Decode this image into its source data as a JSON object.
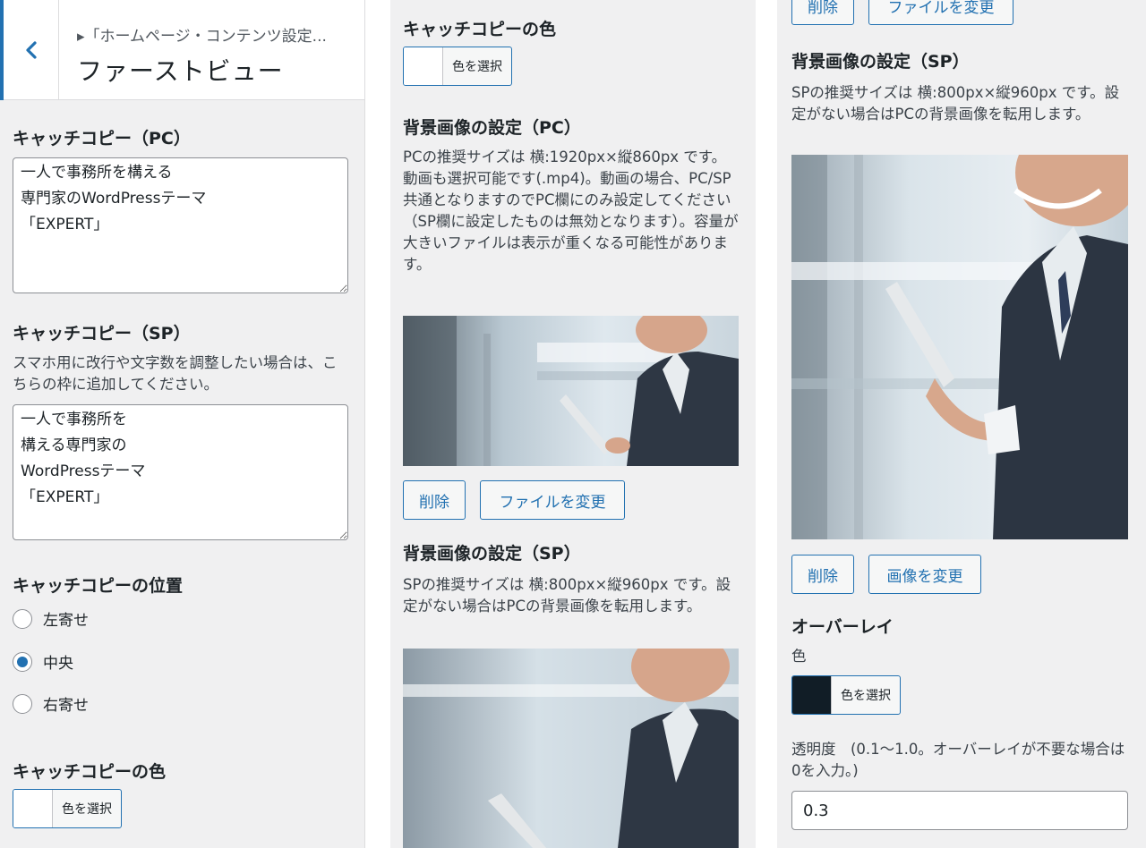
{
  "header": {
    "breadcrumb": "▸「ホームページ・コンテンツ設定...",
    "title": "ファーストビュー",
    "back_icon": "chevron-left-icon"
  },
  "col1": {
    "catch_pc_label": "キャッチコピー（PC）",
    "catch_pc_value": "一人で事務所を構える\n専門家のWordPressテーマ\n「EXPERT」",
    "catch_sp_label": "キャッチコピー（SP）",
    "catch_sp_desc": "スマホ用に改行や文字数を調整したい場合は、こちらの枠に追加してください。",
    "catch_sp_value": "一人で事務所を\n構える専門家の\nWordPressテーマ\n「EXPERT」",
    "position_label": "キャッチコピーの位置",
    "position_options": [
      "左寄せ",
      "中央",
      "右寄せ"
    ],
    "position_selected": "中央",
    "color_label": "キャッチコピーの色",
    "color_button": "色を選択"
  },
  "col2": {
    "color_label": "キャッチコピーの色",
    "color_button": "色を選択",
    "bg_pc_label": "背景画像の設定（PC）",
    "bg_pc_desc": "PCの推奨サイズは 横:1920px×縦860px です。\n動画も選択可能です(.mp4)。動画の場合、PC/SP共通となりますのでPC欄にのみ設定してください（SP欄に設定したものは無効となります）。容量が大きいファイルは表示が重くなる可能性があります。",
    "remove_button": "削除",
    "change_file_button": "ファイルを変更",
    "bg_sp_label": "背景画像の設定（SP）",
    "bg_sp_desc": "SPの推奨サイズは 横:800px×縦960px です。設定がない場合はPCの背景画像を転用します。"
  },
  "col3": {
    "remove_button_top": "削除",
    "change_file_button_top": "ファイルを変更",
    "bg_sp_label": "背景画像の設定（SP）",
    "bg_sp_desc": "SPの推奨サイズは 横:800px×縦960px です。設定がない場合はPCの背景画像を転用します。",
    "remove_button": "削除",
    "change_image_button": "画像を変更",
    "overlay_label": "オーバーレイ",
    "overlay_color_label": "色",
    "overlay_color_button": "色を選択",
    "overlay_color": "#111d26",
    "opacity_label": "透明度　(0.1〜1.0。オーバーレイが不要な場合は0を入力。)",
    "opacity_value": "0.3"
  },
  "colors": {
    "accent": "#2271b1",
    "panel_bg": "#f0f0f1"
  }
}
